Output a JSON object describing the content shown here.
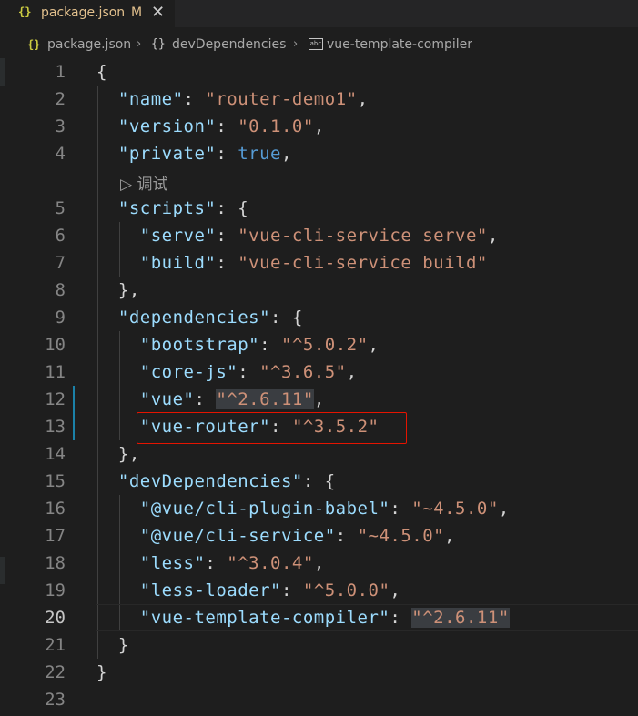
{
  "tab": {
    "icon": "{}",
    "filename": "package.json",
    "status": "M",
    "close": "✕"
  },
  "breadcrumb": {
    "file_icon": "{}",
    "file": "package.json",
    "sep1": "›",
    "obj_icon": "{}",
    "section": "devDependencies",
    "sep2": "›",
    "prop_icon": "abc",
    "property": "vue-template-compiler"
  },
  "codelens": "▷ 调试",
  "lines": [
    {
      "num": "1"
    },
    {
      "num": "2"
    },
    {
      "num": "3"
    },
    {
      "num": "4"
    },
    {
      "num": "5"
    },
    {
      "num": "6"
    },
    {
      "num": "7"
    },
    {
      "num": "8"
    },
    {
      "num": "9"
    },
    {
      "num": "10"
    },
    {
      "num": "11"
    },
    {
      "num": "12"
    },
    {
      "num": "13"
    },
    {
      "num": "14"
    },
    {
      "num": "15"
    },
    {
      "num": "16"
    },
    {
      "num": "17"
    },
    {
      "num": "18"
    },
    {
      "num": "19"
    },
    {
      "num": "20"
    },
    {
      "num": "21"
    },
    {
      "num": "22"
    },
    {
      "num": "23"
    }
  ],
  "code": {
    "l1": "{",
    "l2_key": "\"name\"",
    "l2_val": "\"router-demo1\"",
    "l3_key": "\"version\"",
    "l3_val": "\"0.1.0\"",
    "l4_key": "\"private\"",
    "l4_val": "true",
    "l5_key": "\"scripts\"",
    "l6_key": "\"serve\"",
    "l6_val": "\"vue-cli-service serve\"",
    "l7_key": "\"build\"",
    "l7_val": "\"vue-cli-service build\"",
    "l8": "},",
    "l9_key": "\"dependencies\"",
    "l10_key": "\"bootstrap\"",
    "l10_val": "\"^5.0.2\"",
    "l11_key": "\"core-js\"",
    "l11_val": "\"^3.6.5\"",
    "l12_key": "\"vue\"",
    "l12_val": "\"^2.6.11\"",
    "l13_key": "\"vue-router\"",
    "l13_val": "\"^3.5.2\"",
    "l14": "},",
    "l15_key": "\"devDependencies\"",
    "l16_key": "\"@vue/cli-plugin-babel\"",
    "l16_val": "\"~4.5.0\"",
    "l17_key": "\"@vue/cli-service\"",
    "l17_val": "\"~4.5.0\"",
    "l18_key": "\"less\"",
    "l18_val": "\"^3.0.4\"",
    "l19_key": "\"less-loader\"",
    "l19_val": "\"^5.0.0\"",
    "l20_key": "\"vue-template-compiler\"",
    "l20_val": "\"^2.6.11\"",
    "l21": "}",
    "l22": "}"
  },
  "colors": {
    "key": "#9cdcfe",
    "string": "#ce9178",
    "boolean": "#569cd6",
    "highlight_border": "#e51400",
    "gutter_modified": "#1b81a8"
  },
  "active_line": "20"
}
